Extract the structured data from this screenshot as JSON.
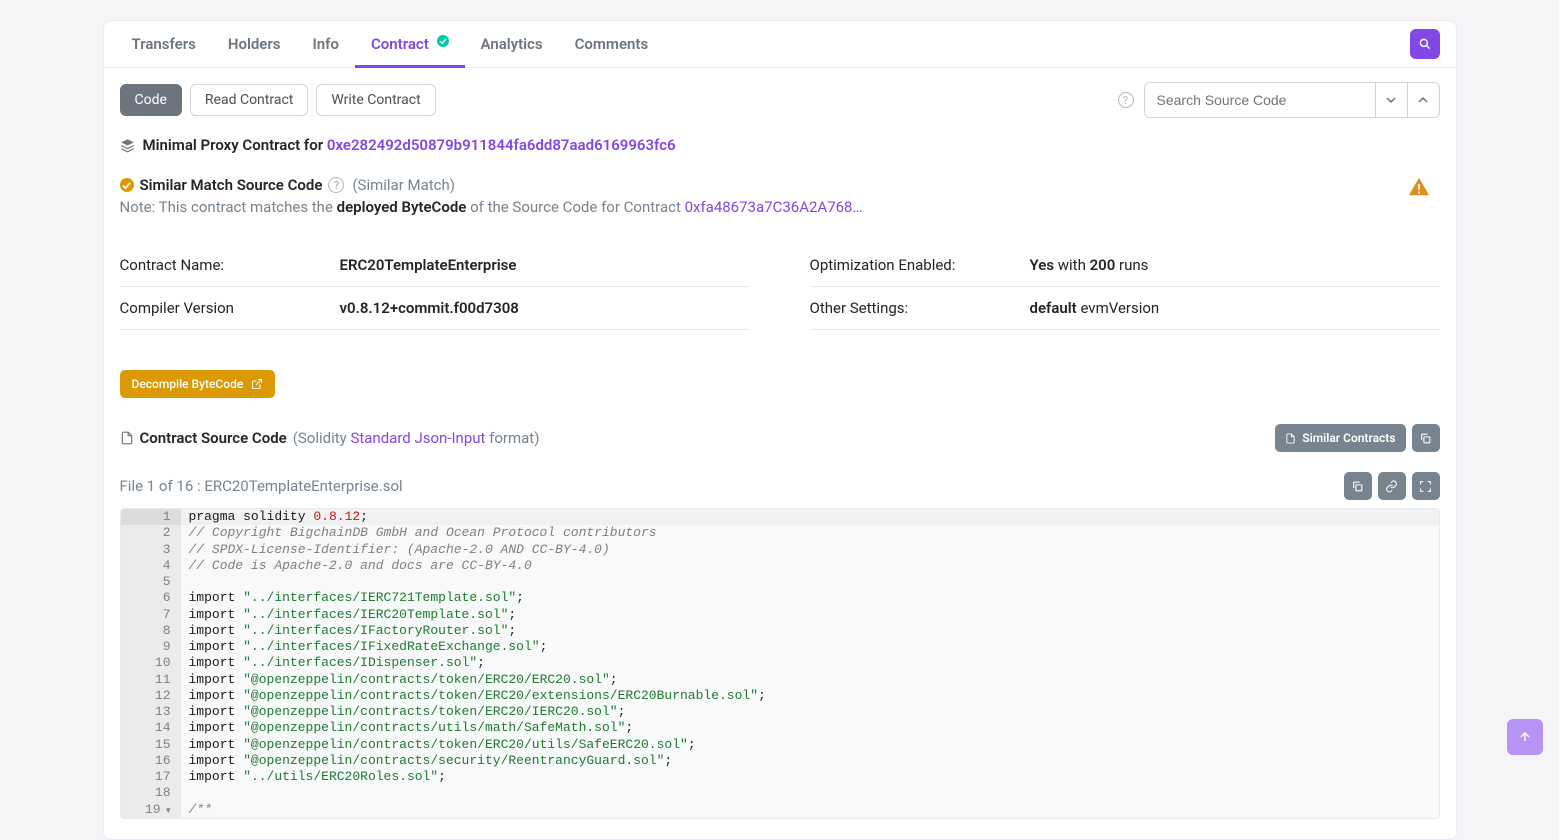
{
  "tabs": {
    "transfers": "Transfers",
    "holders": "Holders",
    "info": "Info",
    "contract": "Contract",
    "analytics": "Analytics",
    "comments": "Comments"
  },
  "subtabs": {
    "code": "Code",
    "read": "Read Contract",
    "write": "Write Contract"
  },
  "search": {
    "placeholder": "Search Source Code"
  },
  "proxy": {
    "label": "Minimal Proxy Contract for ",
    "address": "0xe282492d50879b911844fa6dd87aad6169963fc6"
  },
  "match": {
    "title": "Similar Match Source Code",
    "meta": "(Similar Match)",
    "note_prefix": "Note: This contract matches the ",
    "note_bold": "deployed ByteCode",
    "note_mid": " of the Source Code for Contract ",
    "note_addr": "0xfa48673a7C36A2A768…"
  },
  "info": {
    "contract_name_label": "Contract Name:",
    "contract_name_value": "ERC20TemplateEnterprise",
    "compiler_label": "Compiler Version",
    "compiler_value": "v0.8.12+commit.f00d7308",
    "opt_label": "Optimization Enabled:",
    "opt_yes": "Yes",
    "opt_with": " with ",
    "opt_runs": "200",
    "opt_runs_suffix": " runs",
    "other_label": "Other Settings:",
    "other_bold": "default",
    "other_rest": " evmVersion"
  },
  "decompile_label": "Decompile ByteCode",
  "source": {
    "title": "Contract Source Code",
    "meta1": "(Solidity ",
    "link": "Standard Json-Input",
    "meta2": " format)",
    "similar_btn": "Similar Contracts"
  },
  "file_label": "File 1 of 16 : ERC20TemplateEnterprise.sol",
  "code_lines": [
    {
      "n": 1,
      "active": true,
      "tokens": [
        [
          "kw",
          "pragma"
        ],
        [
          "plain",
          " "
        ],
        [
          "kw",
          "solidity"
        ],
        [
          "plain",
          " "
        ],
        [
          "num",
          "0.8.12"
        ],
        [
          "plain",
          ";"
        ]
      ]
    },
    {
      "n": 2,
      "tokens": [
        [
          "cmt",
          "// Copyright BigchainDB GmbH and Ocean Protocol contributors"
        ]
      ]
    },
    {
      "n": 3,
      "tokens": [
        [
          "cmt",
          "// SPDX-License-Identifier: (Apache-2.0 AND CC-BY-4.0)"
        ]
      ]
    },
    {
      "n": 4,
      "tokens": [
        [
          "cmt",
          "// Code is Apache-2.0 and docs are CC-BY-4.0"
        ]
      ]
    },
    {
      "n": 5,
      "tokens": []
    },
    {
      "n": 6,
      "tokens": [
        [
          "kw",
          "import"
        ],
        [
          "plain",
          " "
        ],
        [
          "str",
          "\"../interfaces/IERC721Template.sol\""
        ],
        [
          "plain",
          ";"
        ]
      ]
    },
    {
      "n": 7,
      "tokens": [
        [
          "kw",
          "import"
        ],
        [
          "plain",
          " "
        ],
        [
          "str",
          "\"../interfaces/IERC20Template.sol\""
        ],
        [
          "plain",
          ";"
        ]
      ]
    },
    {
      "n": 8,
      "tokens": [
        [
          "kw",
          "import"
        ],
        [
          "plain",
          " "
        ],
        [
          "str",
          "\"../interfaces/IFactoryRouter.sol\""
        ],
        [
          "plain",
          ";"
        ]
      ]
    },
    {
      "n": 9,
      "tokens": [
        [
          "kw",
          "import"
        ],
        [
          "plain",
          " "
        ],
        [
          "str",
          "\"../interfaces/IFixedRateExchange.sol\""
        ],
        [
          "plain",
          ";"
        ]
      ]
    },
    {
      "n": 10,
      "tokens": [
        [
          "kw",
          "import"
        ],
        [
          "plain",
          " "
        ],
        [
          "str",
          "\"../interfaces/IDispenser.sol\""
        ],
        [
          "plain",
          ";"
        ]
      ]
    },
    {
      "n": 11,
      "tokens": [
        [
          "kw",
          "import"
        ],
        [
          "plain",
          " "
        ],
        [
          "str",
          "\"@openzeppelin/contracts/token/ERC20/ERC20.sol\""
        ],
        [
          "plain",
          ";"
        ]
      ]
    },
    {
      "n": 12,
      "tokens": [
        [
          "kw",
          "import"
        ],
        [
          "plain",
          " "
        ],
        [
          "str",
          "\"@openzeppelin/contracts/token/ERC20/extensions/ERC20Burnable.sol\""
        ],
        [
          "plain",
          ";"
        ]
      ]
    },
    {
      "n": 13,
      "tokens": [
        [
          "kw",
          "import"
        ],
        [
          "plain",
          " "
        ],
        [
          "str",
          "\"@openzeppelin/contracts/token/ERC20/IERC20.sol\""
        ],
        [
          "plain",
          ";"
        ]
      ]
    },
    {
      "n": 14,
      "tokens": [
        [
          "kw",
          "import"
        ],
        [
          "plain",
          " "
        ],
        [
          "str",
          "\"@openzeppelin/contracts/utils/math/SafeMath.sol\""
        ],
        [
          "plain",
          ";"
        ]
      ]
    },
    {
      "n": 15,
      "tokens": [
        [
          "kw",
          "import"
        ],
        [
          "plain",
          " "
        ],
        [
          "str",
          "\"@openzeppelin/contracts/token/ERC20/utils/SafeERC20.sol\""
        ],
        [
          "plain",
          ";"
        ]
      ]
    },
    {
      "n": 16,
      "tokens": [
        [
          "kw",
          "import"
        ],
        [
          "plain",
          " "
        ],
        [
          "str",
          "\"@openzeppelin/contracts/security/ReentrancyGuard.sol\""
        ],
        [
          "plain",
          ";"
        ]
      ]
    },
    {
      "n": 17,
      "tokens": [
        [
          "kw",
          "import"
        ],
        [
          "plain",
          " "
        ],
        [
          "str",
          "\"../utils/ERC20Roles.sol\""
        ],
        [
          "plain",
          ";"
        ]
      ]
    },
    {
      "n": 18,
      "tokens": []
    },
    {
      "n": 19,
      "fold": true,
      "tokens": [
        [
          "cmt",
          "/**"
        ]
      ]
    }
  ]
}
